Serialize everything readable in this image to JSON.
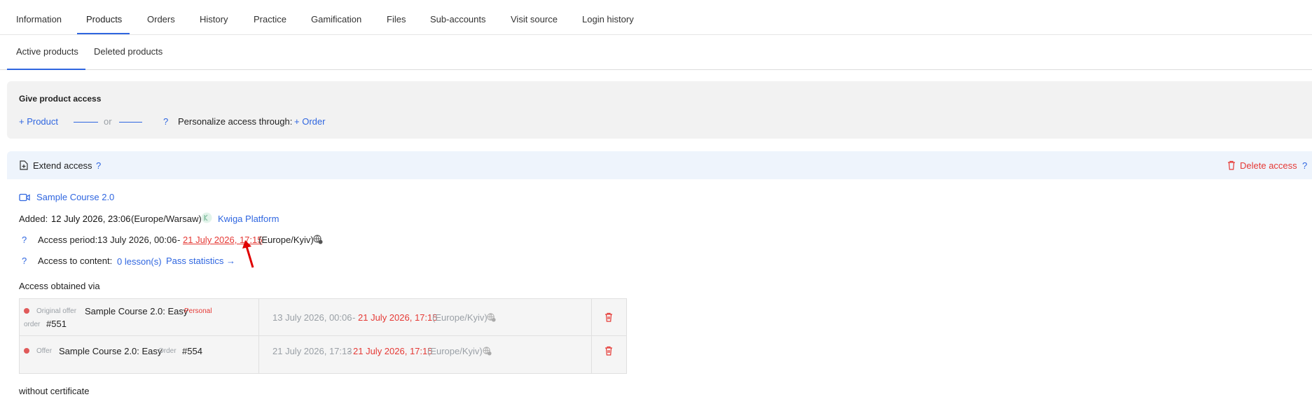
{
  "tabs": {
    "items": [
      "Information",
      "Products",
      "Orders",
      "History",
      "Practice",
      "Gamification",
      "Files",
      "Sub-accounts",
      "Visit source",
      "Login history"
    ],
    "active": "Products"
  },
  "subtabs": {
    "items": [
      "Active products",
      "Deleted products"
    ],
    "active": "Active products"
  },
  "give_access": {
    "title": "Give product access",
    "add_product": "+ Product",
    "or": "or",
    "help": "?",
    "personalize_label": "Personalize access through:",
    "add_order": "+ Order"
  },
  "extend": {
    "label": "Extend access",
    "help": "?",
    "delete_label": "Delete access",
    "delete_help": "?"
  },
  "product": {
    "name": "Sample Course 2.0",
    "added_label": "Added:",
    "added_date": "12 July 2026, 23:06",
    "added_tz": "(Europe/Warsaw)",
    "platform": "Kwiga Platform",
    "period_help": "?",
    "period_label": "Access period:",
    "period_start": "13 July 2026, 00:06",
    "period_sep": "-",
    "period_end": "21 July 2026, 17:15",
    "period_tz": "(Europe/Kyiv)",
    "content_help": "?",
    "content_label": "Access to content:",
    "lessons": "0 lesson(s)",
    "pass_stats": "Pass statistics →"
  },
  "obtained": {
    "title": "Access obtained via",
    "rows": [
      {
        "type_label": "Original offer",
        "offer_name": "Sample Course 2.0: Easy",
        "badge": "Personal",
        "order_label": "order",
        "order_no": "#551",
        "start": "13 July 2026, 00:06",
        "sep": "-",
        "end": "21 July 2026, 17:15",
        "tz": "(Europe/Kyiv)"
      },
      {
        "type_label": "Offer",
        "offer_name": "Sample Course 2.0: Easy",
        "order_label": "Order",
        "order_no": "#554",
        "start": "21 July 2026, 17:13",
        "sep": "-",
        "end": "21 July 2026, 17:15",
        "tz": "(Europe/Kyiv)"
      }
    ]
  },
  "certificate": "without certificate",
  "colors": {
    "accent": "#2f66e0",
    "danger": "#e53935",
    "panel": "#f2f2f2",
    "ext_bar": "#eef4fc"
  }
}
